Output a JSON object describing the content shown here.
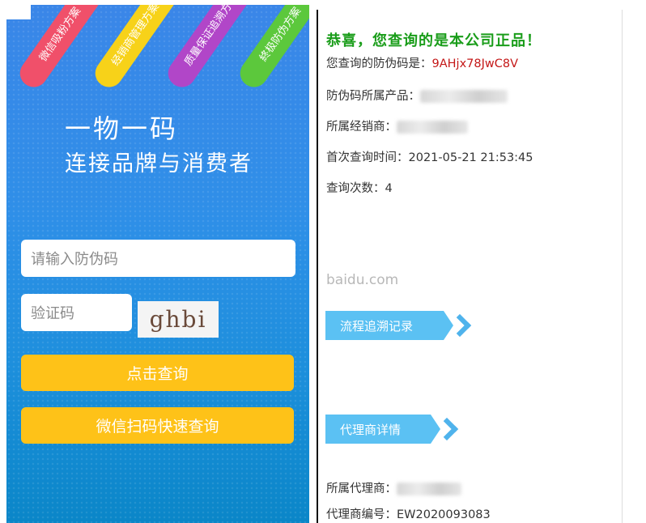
{
  "left": {
    "ribbons": [
      "微信吸粉方案",
      "经销商管理方案",
      "质量保证追溯方",
      "終极防伪方案"
    ],
    "slogan_line1": "一物一码",
    "slogan_line2": "连接品牌与消费者",
    "code_placeholder": "请输入防伪码",
    "captcha_placeholder": "验证码",
    "captcha_text": "ghbi",
    "query_button": "点击查询",
    "wechat_button": "微信扫码快速查询"
  },
  "right": {
    "headline": "恭喜，您查询的是本公司正品！",
    "code_label": "您查询的防伪码是：",
    "code_value": "9AHjx78JwC8V",
    "product_label": "防伪码所属产品：",
    "dealer_label": "所属经销商：",
    "first_query_label": "首次查询时间：",
    "first_query_value": "2021-05-21 21:53:45",
    "query_count_label": "查询次数：",
    "query_count_value": "4",
    "watermark": "baidu.com",
    "trace_tag": "流程追溯记录",
    "agent_tag": "代理商详情",
    "agent_label": "所属代理商：",
    "agent_no_label": "代理商编号：",
    "agent_no_value": "EW2020093083"
  },
  "colors": {
    "headline_green": "#1a9d1a",
    "code_red": "#c41818",
    "button_yellow": "#fec218",
    "tag_blue": "#5bc1f3"
  }
}
